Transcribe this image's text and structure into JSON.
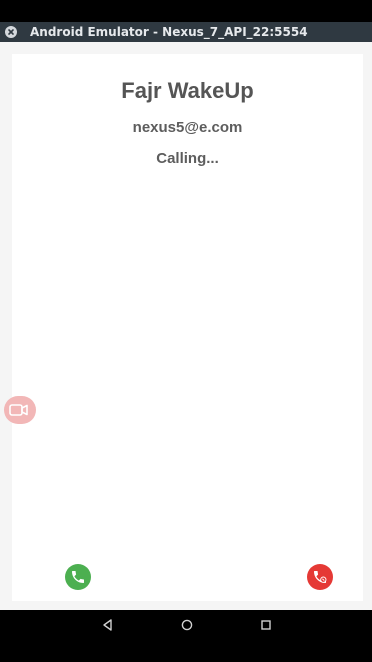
{
  "window": {
    "title": "Android Emulator - Nexus_7_API_22:5554"
  },
  "call": {
    "name": "Fajr WakeUp",
    "email": "nexus5@e.com",
    "status": "Calling..."
  },
  "icons": {
    "close": "close-circle-icon",
    "video": "video-camera-icon",
    "answer": "phone-answer-icon",
    "decline": "phone-decline-icon",
    "back": "triangle-back-icon",
    "home": "circle-home-icon",
    "recents": "square-recents-icon"
  },
  "colors": {
    "answer": "#4caf50",
    "decline": "#e53935",
    "video_toggle": "#f2b7b7",
    "titlebar": "#2f3941"
  }
}
